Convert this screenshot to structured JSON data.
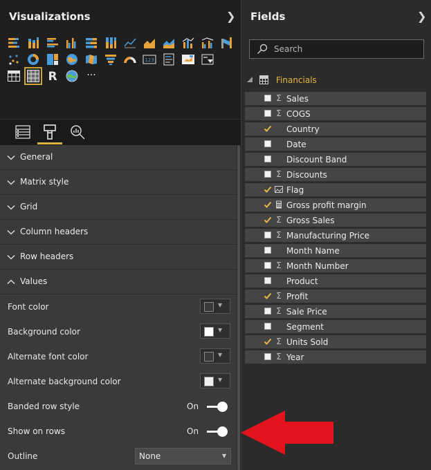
{
  "visualizations": {
    "title": "Visualizations",
    "icons": [
      "stacked-bar-chart-icon",
      "stacked-column-chart-icon",
      "clustered-bar-chart-icon",
      "clustered-column-chart-icon",
      "100-stacked-bar-chart-icon",
      "100-stacked-column-chart-icon",
      "line-chart-icon",
      "area-chart-icon",
      "stacked-area-chart-icon",
      "line-and-column-chart-icon",
      "line-and-clustered-column-chart-icon",
      "ribbon-chart-icon",
      "scatter-chart-icon",
      "donut-chart-icon",
      "treemap-icon",
      "map-icon",
      "filled-map-icon",
      "funnel-icon",
      "gauge-icon",
      "card-icon",
      "multi-row-card-icon",
      "kpi-icon",
      "slicer-icon",
      "table-icon",
      "matrix-icon",
      "r-script-icon",
      "globe-icon",
      "more-icon"
    ],
    "r_glyph": "R",
    "more_glyph": "···",
    "card_glyph": "123",
    "tabs": [
      "fields-tab-icon",
      "format-tab-icon",
      "analytics-tab-icon"
    ],
    "sections": [
      {
        "label": "General",
        "expanded": false
      },
      {
        "label": "Matrix style",
        "expanded": false
      },
      {
        "label": "Grid",
        "expanded": false
      },
      {
        "label": "Column headers",
        "expanded": false
      },
      {
        "label": "Row headers",
        "expanded": false
      },
      {
        "label": "Values",
        "expanded": true
      }
    ],
    "values_props": {
      "font_color": {
        "label": "Font color",
        "swatch": "#3a3a3a"
      },
      "background_color": {
        "label": "Background color",
        "swatch": "#ffffff"
      },
      "alternate_font_color": {
        "label": "Alternate font color",
        "swatch": "#3a3a3a"
      },
      "alternate_background_color": {
        "label": "Alternate background color",
        "swatch": "#f0f0f0"
      },
      "banded_row_style": {
        "label": "Banded row style",
        "state": "On"
      },
      "show_on_rows": {
        "label": "Show on rows",
        "state": "On"
      },
      "outline": {
        "label": "Outline",
        "value": "None"
      }
    }
  },
  "fields": {
    "title": "Fields",
    "search_placeholder": "Search",
    "table_name": "Financials",
    "items": [
      {
        "name": "Sales",
        "checked": false,
        "type": "sum"
      },
      {
        "name": "COGS",
        "checked": false,
        "type": "sum"
      },
      {
        "name": "Country",
        "checked": true,
        "type": "text"
      },
      {
        "name": "Date",
        "checked": false,
        "type": "text"
      },
      {
        "name": "Discount Band",
        "checked": false,
        "type": "text"
      },
      {
        "name": "Discounts",
        "checked": false,
        "type": "sum"
      },
      {
        "name": "Flag",
        "checked": true,
        "type": "image"
      },
      {
        "name": "Gross profit margin",
        "checked": true,
        "type": "measure"
      },
      {
        "name": "Gross Sales",
        "checked": true,
        "type": "sum"
      },
      {
        "name": "Manufacturing Price",
        "checked": false,
        "type": "sum"
      },
      {
        "name": "Month Name",
        "checked": false,
        "type": "text"
      },
      {
        "name": "Month Number",
        "checked": false,
        "type": "sum"
      },
      {
        "name": "Product",
        "checked": false,
        "type": "text"
      },
      {
        "name": "Profit",
        "checked": true,
        "type": "sum"
      },
      {
        "name": "Sale Price",
        "checked": false,
        "type": "sum"
      },
      {
        "name": "Segment",
        "checked": false,
        "type": "text"
      },
      {
        "name": "Units Sold",
        "checked": true,
        "type": "sum"
      },
      {
        "name": "Year",
        "checked": false,
        "type": "sum"
      }
    ],
    "sigma_glyph": "Σ"
  },
  "colors": {
    "accent": "#d9b33d",
    "table_name": "#e8b740",
    "arrow": "#e3141e"
  }
}
